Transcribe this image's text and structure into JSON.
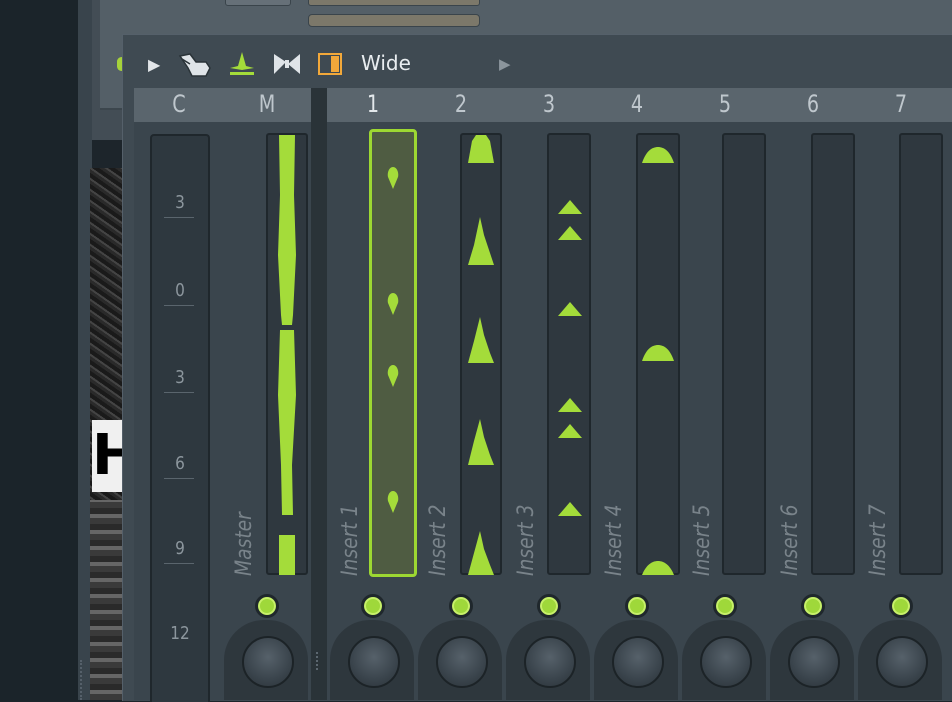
{
  "toolbar": {
    "play_icon": "triangle-right-icon",
    "layout_label": "Wide",
    "accent_color": "#a4dc3a",
    "layout_icon_color": "#f2a83a"
  },
  "columns": {
    "current_label": "C",
    "master_label": "M",
    "insert_numbers": [
      "1",
      "2",
      "3",
      "4",
      "5",
      "6",
      "7"
    ]
  },
  "scale": {
    "ticks": [
      "3",
      "0",
      "3",
      "6",
      "9",
      "12"
    ]
  },
  "channels": [
    {
      "name": "Master",
      "selected": false
    },
    {
      "name": "Insert 1",
      "selected": true
    },
    {
      "name": "Insert 2",
      "selected": false
    },
    {
      "name": "Insert 3",
      "selected": false
    },
    {
      "name": "Insert 4",
      "selected": false
    },
    {
      "name": "Insert 5",
      "selected": false
    },
    {
      "name": "Insert 6",
      "selected": false
    },
    {
      "name": "Insert 7",
      "selected": false
    }
  ],
  "background": {
    "image_text": "H"
  }
}
